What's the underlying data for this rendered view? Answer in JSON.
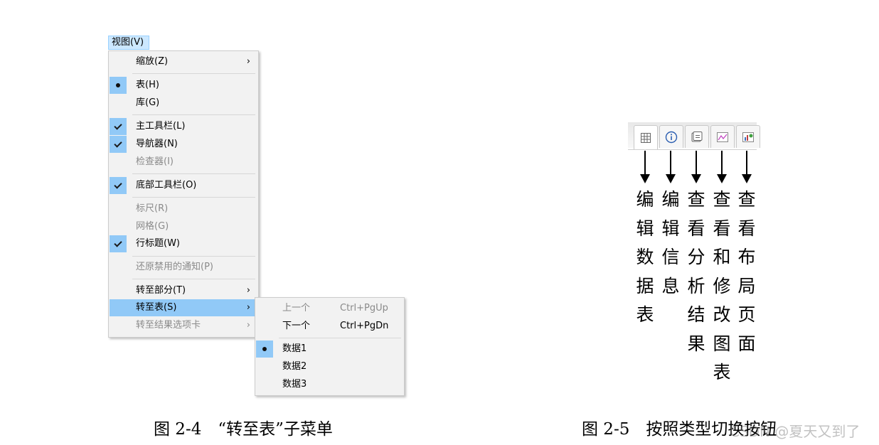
{
  "menubar": {
    "view_menu": "视图(V)"
  },
  "menu": {
    "zoom": "缩放(Z)",
    "table": "表(H)",
    "library": "库(G)",
    "main_toolbar": "主工具栏(L)",
    "navigator": "导航器(N)",
    "inspector": "检查器(I)",
    "bottom_toolbar": "底部工具栏(O)",
    "ruler": "标尺(R)",
    "grid": "网格(G)",
    "row_headers": "行标题(W)",
    "restore_notifications": "还原禁用的通知(P)",
    "goto_section": "转至部分(T)",
    "goto_table": "转至表(S)",
    "goto_results_tab": "转至结果选项卡",
    "submenu_arrow": "›"
  },
  "submenu": {
    "previous": "上一个",
    "previous_shortcut": "Ctrl+PgUp",
    "next": "下一个",
    "next_shortcut": "Ctrl+PgDn",
    "data1": "数据1",
    "data2": "数据2",
    "data3": "数据3"
  },
  "tabs": {
    "labels": [
      "编辑数据表",
      "编辑信息",
      "查看分析结果",
      "查看和修改图表",
      "查看布局页面"
    ],
    "icons": [
      "grid-table-icon",
      "info-icon",
      "results-list-icon",
      "line-chart-icon",
      "layout-chart-icon"
    ]
  },
  "captions": {
    "fig_left": "图 2-4　“转至表”子菜单",
    "fig_right": "图 2-5　按照类型切换按钮"
  },
  "watermark": "CSDN @夏天又到了",
  "colors": {
    "highlight": "#91c9f7",
    "menu_bg": "#f2f2f2",
    "disabled_text": "#8a8a8a"
  }
}
